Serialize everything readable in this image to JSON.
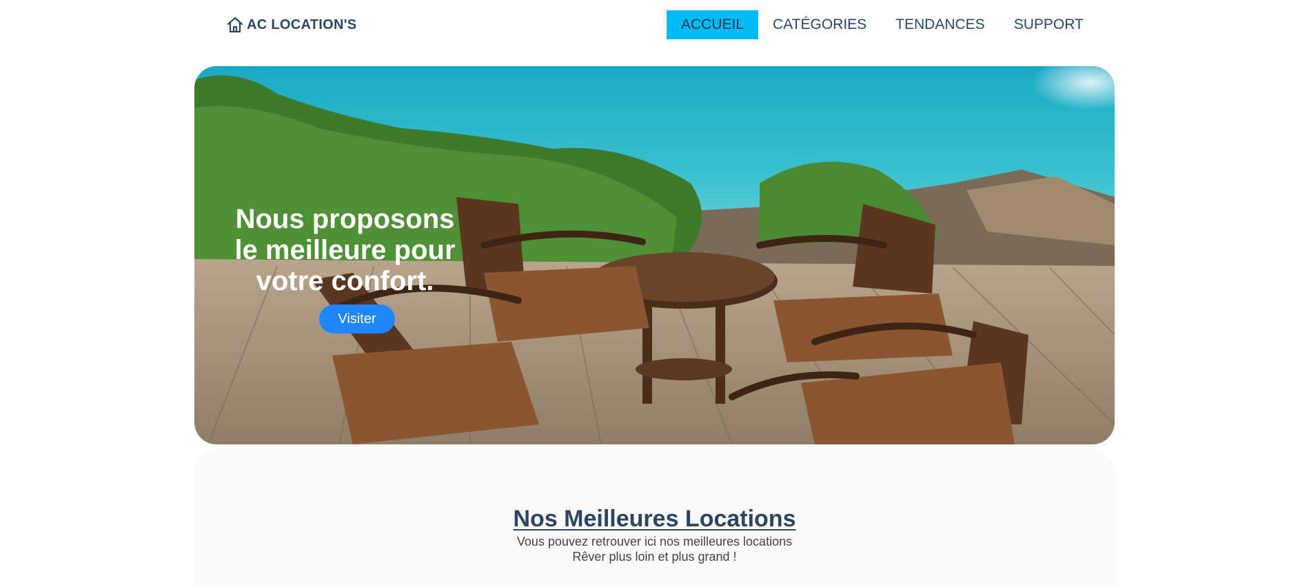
{
  "header": {
    "brand": "AC LOCATION'S",
    "brand_icon": "home-icon",
    "nav": [
      {
        "label": "ACCUEIL",
        "active": true
      },
      {
        "label": "CATÉGORIES",
        "active": false
      },
      {
        "label": "TENDANCES",
        "active": false
      },
      {
        "label": "SUPPORT",
        "active": false
      }
    ]
  },
  "hero": {
    "title": "Nous proposons le meilleure pour votre confort.",
    "button_label": "Visiter"
  },
  "best_rentals": {
    "title": "Nos Meilleures Locations",
    "subtitle_line1": "Vous pouvez retrouver ici nos meilleures locations",
    "subtitle_line2": "Rêver plus loin et plus grand !"
  },
  "colors": {
    "accent": "#00bcf2",
    "button": "#1f86ff",
    "text": "#2c4560"
  }
}
